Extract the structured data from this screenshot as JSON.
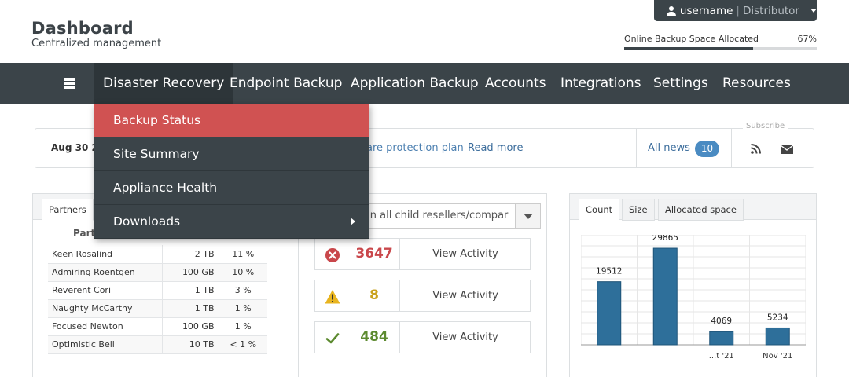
{
  "header": {
    "title": "Dashboard",
    "subtitle": "Centralized management",
    "user": {
      "name": "username",
      "role": "Distributor"
    },
    "allocation": {
      "label": "Online Backup Space Allocated",
      "percent_label": "67%",
      "percent": 67
    }
  },
  "nav": {
    "items": [
      "Disaster Recovery",
      "Endpoint Backup",
      "Application Backup",
      "Accounts",
      "Integrations",
      "Settings",
      "Resources"
    ]
  },
  "dropdown": {
    "items": [
      "Backup Status",
      "Site Summary",
      "Appliance Health",
      "Downloads"
    ]
  },
  "news": {
    "date": "Aug 30 2",
    "text": "are protection plan",
    "read_more": "Read more",
    "all_news": "All news",
    "count": "10",
    "subscribe": "Subscribe"
  },
  "partners_panel": {
    "tabs": [
      "Partners"
    ],
    "column_header": "Part",
    "rows": [
      [
        "Keen Rosalind",
        "2 TB",
        "11 %"
      ],
      [
        "Admiring Roentgen",
        "100 GB",
        "10 %"
      ],
      [
        "Reverent Cori",
        "1 TB",
        "3 %"
      ],
      [
        "Naughty McCarthy",
        "1 TB",
        "1 %"
      ],
      [
        "Focused Newton",
        "100 GB",
        "1 %"
      ],
      [
        "Optimistic Bell",
        "10 TB",
        "< 1 %"
      ]
    ]
  },
  "status_panel": {
    "select_value": "s (In all child resellers/compar",
    "stats": [
      {
        "icon": "error-icon",
        "value": "3647",
        "action": "View Activity",
        "color": "#c9474b"
      },
      {
        "icon": "warning-icon",
        "value": "8",
        "action": "View Activity",
        "color": "#c9a21d"
      },
      {
        "icon": "check-icon",
        "value": "484",
        "action": "View Activity",
        "color": "#5c8a2f"
      }
    ]
  },
  "chart_panel": {
    "tabs": [
      "Count",
      "Size",
      "Allocated space"
    ],
    "active_tab": "Count"
  },
  "chart_data": {
    "type": "bar",
    "categories": [
      "",
      "",
      "Oct '21",
      "Nov '21"
    ],
    "visible_tick_labels": [
      "",
      "",
      "...t '21",
      "Nov '21"
    ],
    "values": [
      19512,
      29865,
      4069,
      5234
    ],
    "ylim": [
      0,
      34000
    ],
    "grid": true,
    "bar_color": "#2e6f9a"
  },
  "colors": {
    "nav_bg": "#3b4449",
    "highlight": "#d05252",
    "link": "#3c6d9c",
    "badge": "#4a8bc2"
  }
}
